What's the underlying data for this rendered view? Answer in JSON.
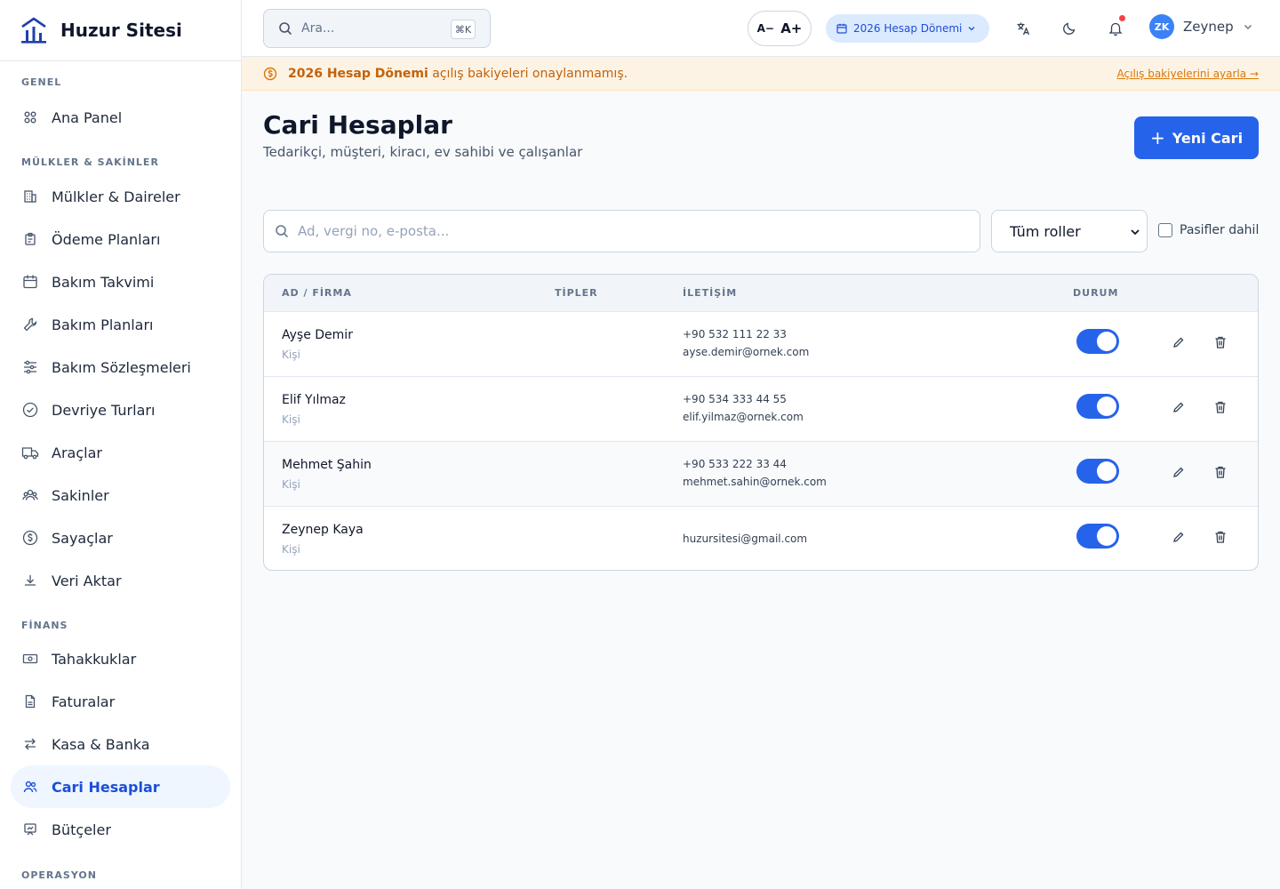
{
  "app": {
    "brand": "Huzur Sitesi"
  },
  "sidebar": {
    "sections": [
      {
        "title": "GENEL"
      },
      {
        "title": "MÜLKLER & SAKİNLER"
      },
      {
        "title": "FİNANS"
      },
      {
        "title": "OPERASYON"
      }
    ],
    "items": [
      {
        "label": "Ana Panel",
        "icon": "grid-icon"
      },
      {
        "label": "Mülkler & Daireler",
        "icon": "building-icon"
      },
      {
        "label": "Ödeme Planları",
        "icon": "clipboard-icon"
      },
      {
        "label": "Bakım Takvimi",
        "icon": "calendar-icon"
      },
      {
        "label": "Bakım Planları",
        "icon": "wrench-icon"
      },
      {
        "label": "Bakım Sözleşmeleri",
        "icon": "sliders-icon"
      },
      {
        "label": "Devriye Turları",
        "icon": "check-circle-icon"
      },
      {
        "label": "Araçlar",
        "icon": "truck-icon"
      },
      {
        "label": "Sakinler",
        "icon": "users-icon"
      },
      {
        "label": "Sayaçlar",
        "icon": "dollar-circle-icon"
      },
      {
        "label": "Veri Aktar",
        "icon": "download-icon"
      },
      {
        "label": "Tahakkuklar",
        "icon": "banknote-icon"
      },
      {
        "label": "Faturalar",
        "icon": "file-icon"
      },
      {
        "label": "Kasa & Banka",
        "icon": "transfer-icon"
      },
      {
        "label": "Cari Hesaplar",
        "icon": "users-icon",
        "active": true
      },
      {
        "label": "Bütçeler",
        "icon": "presentation-icon"
      }
    ]
  },
  "topbar": {
    "search_placeholder": "Ara...",
    "shortcut": "⌘K",
    "font_decrease": "A−",
    "font_increase": "A+",
    "period": "2026 Hesap Dönemi",
    "user_initials": "ZK",
    "user_name": "Zeynep"
  },
  "banner": {
    "strong": "2026 Hesap Dönemi",
    "text": " açılış bakiyeleri onaylanmamış.",
    "link": "Açılış bakiyelerini ayarla →"
  },
  "page": {
    "title": "Cari Hesaplar",
    "subtitle": "Tedarikçi, müşteri, kiracı, ev sahibi ve çalışanlar",
    "new_button": "Yeni Cari"
  },
  "filters": {
    "search_placeholder": "Ad, vergi no, e-posta...",
    "role_select": "Tüm roller",
    "include_inactive": "Pasifler dahil",
    "include_inactive_checked": false
  },
  "table": {
    "headers": [
      "AD / FİRMA",
      "TİPLER",
      "İLETİŞİM",
      "DURUM"
    ],
    "rows": [
      {
        "name": "Ayşe Demir",
        "type": "Kişi",
        "phone": "+90 532 111 22 33",
        "email": "ayse.demir@ornek.com",
        "active": true
      },
      {
        "name": "Elif Yılmaz",
        "type": "Kişi",
        "phone": "+90 534 333 44 55",
        "email": "elif.yilmaz@ornek.com",
        "active": true
      },
      {
        "name": "Mehmet Şahin",
        "type": "Kişi",
        "phone": "+90 533 222 33 44",
        "email": "mehmet.sahin@ornek.com",
        "active": true
      },
      {
        "name": "Zeynep Kaya",
        "type": "Kişi",
        "phone": "",
        "email": "huzursitesi@gmail.com",
        "active": true
      }
    ]
  },
  "colors": {
    "accent": "#2563eb",
    "banner_bg": "#fdf3e4",
    "banner_text": "#c2620a",
    "notification_dot": "#ef4444"
  }
}
